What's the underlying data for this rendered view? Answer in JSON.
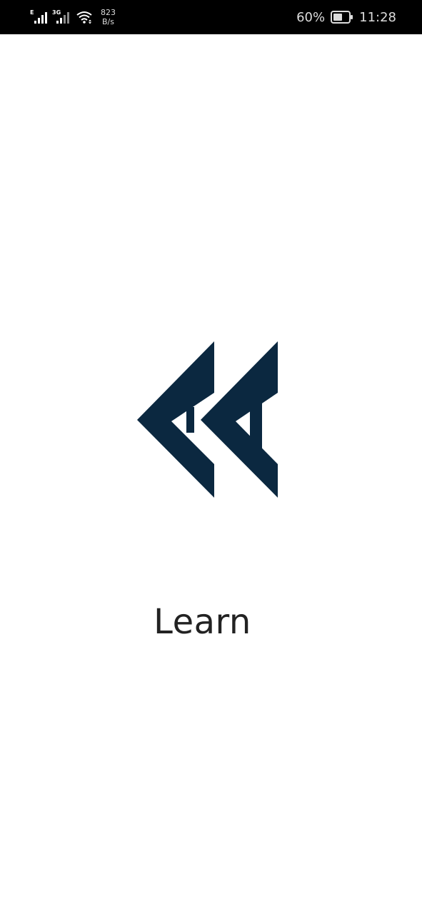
{
  "status_bar": {
    "network_1_type": "E",
    "network_2_type": "3G",
    "speed_value": "823",
    "speed_unit": "B/s",
    "battery_percent": "60%",
    "battery_level": 0.6,
    "time": "11:28",
    "icons": [
      "signal-icon",
      "signal-icon",
      "wifi-icon",
      "battery-icon"
    ]
  },
  "splash": {
    "logo_icon": "double-chevron-logo-icon",
    "logo_color": "#0b2840",
    "title": "Learn"
  }
}
